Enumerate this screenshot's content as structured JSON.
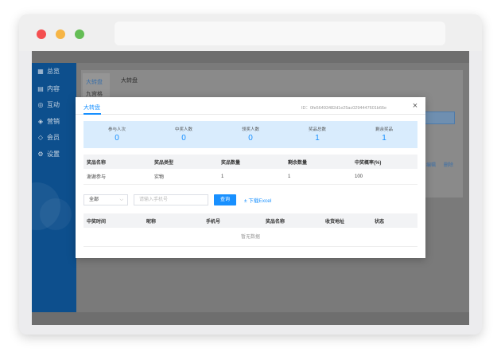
{
  "sidebar": {
    "items": [
      {
        "icon": "grid-icon",
        "glyph": "▦",
        "label": "总览"
      },
      {
        "icon": "doc-icon",
        "glyph": "▤",
        "label": "内容"
      },
      {
        "icon": "chat-icon",
        "glyph": "◎",
        "label": "互动"
      },
      {
        "icon": "tag-icon",
        "glyph": "◈",
        "label": "营销"
      },
      {
        "icon": "diamond-icon",
        "glyph": "◇",
        "label": "会员"
      },
      {
        "icon": "gear-icon",
        "glyph": "⚙",
        "label": "设置"
      }
    ]
  },
  "background": {
    "tab1": "大转盘",
    "tab2": "九宫格",
    "title": "大转盘",
    "link_a": "编辑",
    "link_b": "删除"
  },
  "modal": {
    "tab_label": "大转盘",
    "id_text": "ID：0fe56493482d1e25ac0294447601b66e",
    "close_glyph": "×",
    "stats": [
      {
        "label": "参与人次",
        "value": "0"
      },
      {
        "label": "中奖人数",
        "value": "0"
      },
      {
        "label": "领奖人数",
        "value": "0"
      },
      {
        "label": "奖品总数",
        "value": "1"
      },
      {
        "label": "剩余奖品",
        "value": "1"
      }
    ],
    "prize_table": {
      "headers": [
        "奖品名称",
        "奖品类型",
        "奖品数量",
        "剩余数量",
        "中奖概率(%)"
      ],
      "rows": [
        [
          "谢谢参与",
          "实物",
          "1",
          "1",
          "100"
        ]
      ]
    },
    "filters": {
      "select_value": "全部",
      "select_chevron": "⌵",
      "phone_placeholder": "请输入手机号",
      "query_label": "查询",
      "download_label": "± 下载Excel"
    },
    "record_table": {
      "headers": [
        "中奖时间",
        "昵称",
        "手机号",
        "奖品名称",
        "收货地址",
        "状态"
      ],
      "empty_text": "暂无数据"
    }
  },
  "colors": {
    "accent": "#1890ff",
    "sidebar": "#0d4f8d",
    "stats_bg": "#d9ecfd"
  }
}
